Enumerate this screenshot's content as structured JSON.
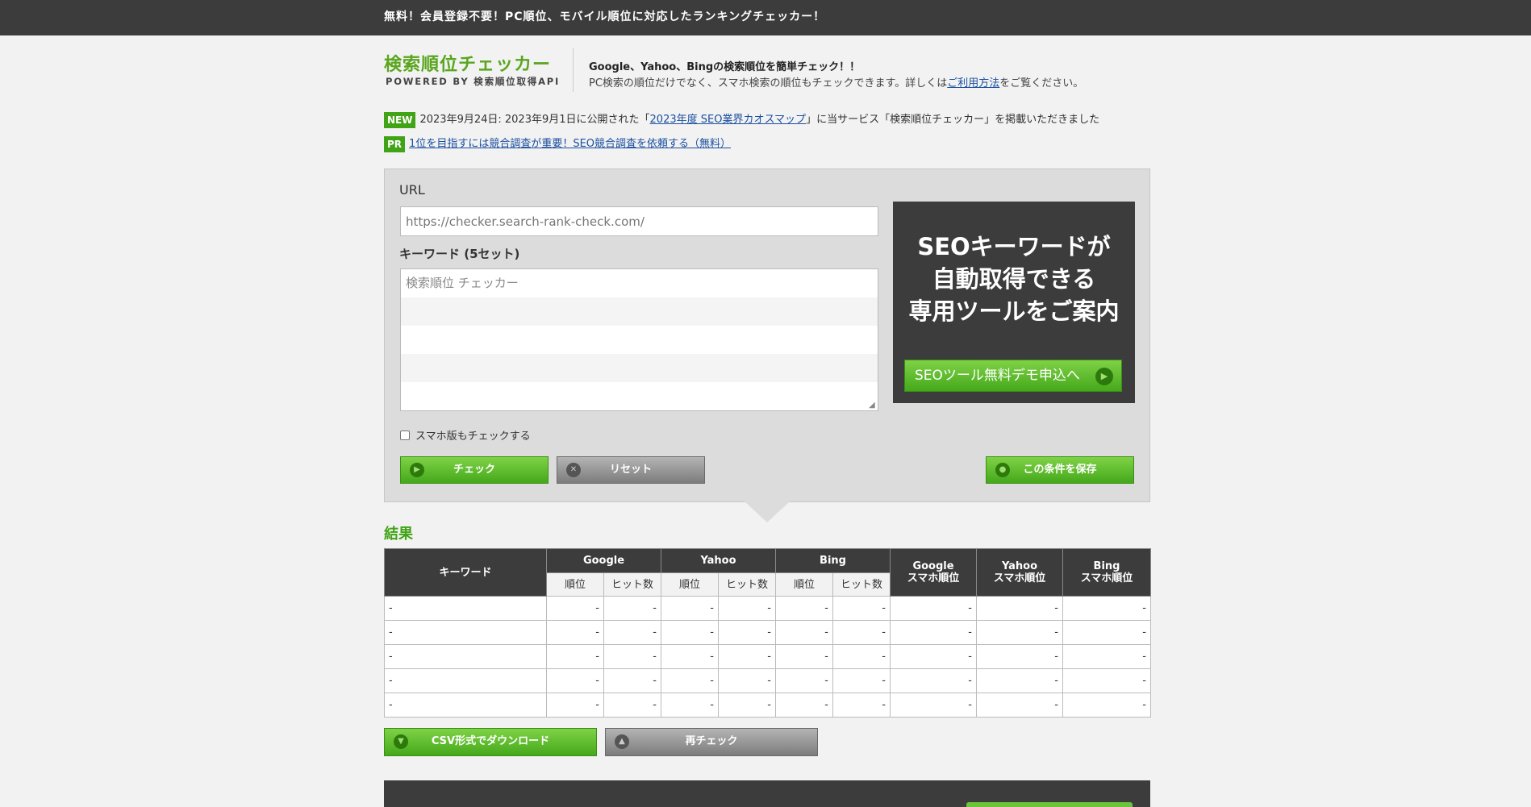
{
  "top_bar": {
    "tagline": "無料！会員登録不要！PC順位、モバイル順位に対応したランキングチェッカー！"
  },
  "logo": {
    "title": "検索順位チェッカー",
    "subtitle": "POWERED BY 検索順位取得API"
  },
  "intro": {
    "headline": "Google、Yahoo、Bingの検索順位を簡単チェック！！",
    "body_prefix": "PC検索の順位だけでなく、スマホ検索の順位もチェックできます。詳しくは",
    "link_label": "ご利用方法",
    "body_suffix": "をご覧ください。"
  },
  "news": [
    {
      "badge": "NEW",
      "text_prefix": "2023年9月24日: 2023年9月1日に公開された「",
      "link_label": "2023年度 SEO業界カオスマップ",
      "text_suffix": "」に当サービス「検索順位チェッカー」を掲載いただきました"
    },
    {
      "badge": "PR",
      "link_label": "1位を目指すには競合調査が重要！SEO競合調査を依頼する（無料）"
    }
  ],
  "form": {
    "url_label": "URL",
    "url_placeholder": "https://checker.search-rank-check.com/",
    "keyword_label": "キーワード (5セット)",
    "keyword_placeholder": "検索順位 チェッカー",
    "mobile_check_label": "スマホ版もチェックする",
    "check_button": "チェック",
    "reset_button": "リセット",
    "save_button": "この条件を保存"
  },
  "ad": {
    "lines": [
      "SEOキーワードが",
      "自動取得できる",
      "専用ツールをご案内"
    ],
    "button": "SEOツール無料デモ申込へ"
  },
  "results": {
    "title": "結果",
    "headers": {
      "keyword": "キーワード",
      "google": "Google",
      "yahoo": "Yahoo",
      "bing": "Bing",
      "rank": "順位",
      "hits": "ヒット数",
      "google_mobile": [
        "Google",
        "スマホ順位"
      ],
      "yahoo_mobile": [
        "Yahoo",
        "スマホ順位"
      ],
      "bing_mobile": [
        "Bing",
        "スマホ順位"
      ]
    },
    "rows": [
      [
        "-",
        "-",
        "-",
        "-",
        "-",
        "-",
        "-",
        "-",
        "-",
        "-"
      ],
      [
        "-",
        "-",
        "-",
        "-",
        "-",
        "-",
        "-",
        "-",
        "-",
        "-"
      ],
      [
        "-",
        "-",
        "-",
        "-",
        "-",
        "-",
        "-",
        "-",
        "-",
        "-"
      ],
      [
        "-",
        "-",
        "-",
        "-",
        "-",
        "-",
        "-",
        "-",
        "-",
        "-"
      ],
      [
        "-",
        "-",
        "-",
        "-",
        "-",
        "-",
        "-",
        "-",
        "-",
        "-"
      ]
    ],
    "csv_button": "CSV形式でダウンロード",
    "recheck_button": "再チェック"
  }
}
